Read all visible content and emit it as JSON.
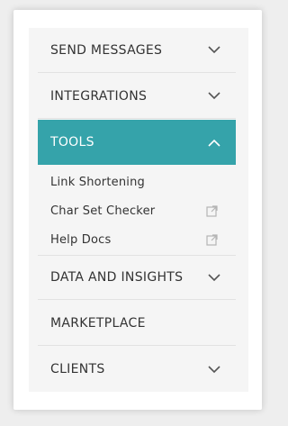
{
  "menu": {
    "send_messages": "SEND MESSAGES",
    "integrations": "INTEGRATIONS",
    "tools": "TOOLS",
    "tools_sub": {
      "link_shortening": "Link Shortening",
      "char_set_checker": "Char Set Checker",
      "help_docs": "Help Docs"
    },
    "data_and_insights": "DATA AND INSIGHTS",
    "marketplace": "MARKETPLACE",
    "clients": "CLIENTS"
  },
  "colors": {
    "active_bg": "#35a3aa",
    "text": "#333333",
    "icon": "#555555",
    "external_icon": "#b5b5b5"
  },
  "icons": {
    "expand": "chevron-down-icon",
    "collapse": "chevron-up-icon",
    "external": "external-link-icon"
  }
}
